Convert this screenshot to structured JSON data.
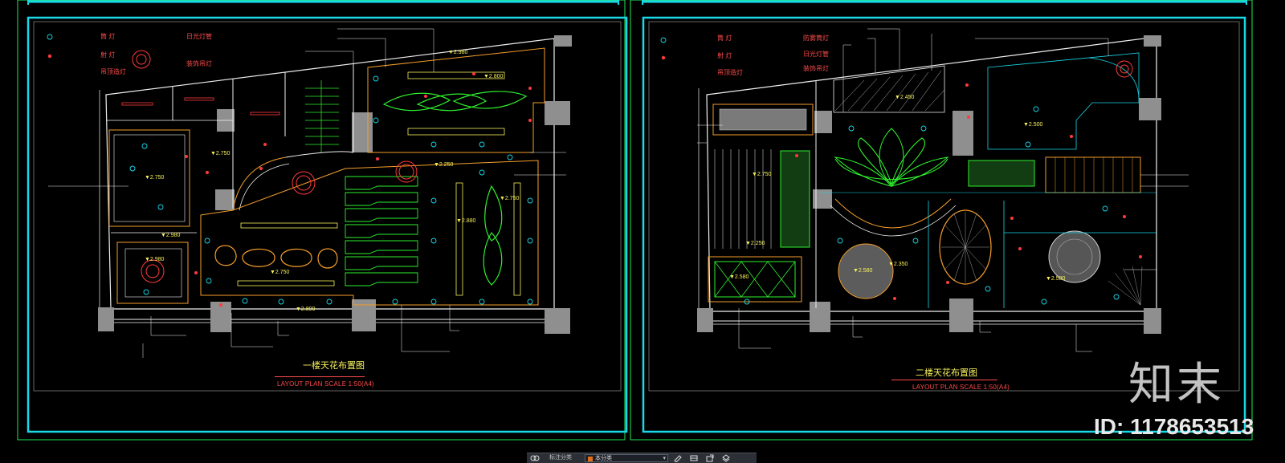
{
  "plans": [
    {
      "title": "一楼天花布置图",
      "caption": "LAYOUT PLAN      SCALE    1:50(A4)"
    },
    {
      "title": "二楼天花布置图",
      "caption": "LAYOUT PLAN      SCALE    1:50(A4)"
    }
  ],
  "legend_left": [
    "筒 灯",
    "射 灯",
    "吊顶造灯",
    "日光灯管",
    "装饰吊灯"
  ],
  "legend_right": [
    "筒 灯",
    "射 灯",
    "吊顶造灯",
    "防雾筒灯",
    "日光灯管",
    "装饰吊灯"
  ],
  "levels_left": [
    "▼2.980",
    "▼2.800",
    "▼2.750",
    "▼2.750",
    "▼2.250",
    "▼2.980",
    "▼2.750",
    "▼2.880",
    "▼2.750",
    "▼2.980",
    "▼2.800"
  ],
  "levels_right": [
    "▼2.450",
    "▼2.500",
    "▼2.350",
    "▼2.580",
    "▼2.580",
    "▼2.750",
    "▼2.250",
    "▼2.580"
  ],
  "watermark": {
    "brand": "知末",
    "id": "ID: 1178653513"
  },
  "toolbar": {
    "layer_label": "标注分类",
    "layer_value": "本分类"
  },
  "colors": {
    "frame": "#19d8e8",
    "wall": "#f0f0f0",
    "accent_yellow": "#f6f05a",
    "accent_red": "#ff3a3a",
    "accent_green": "#2ef02e",
    "accent_orange": "#f59e2b"
  }
}
